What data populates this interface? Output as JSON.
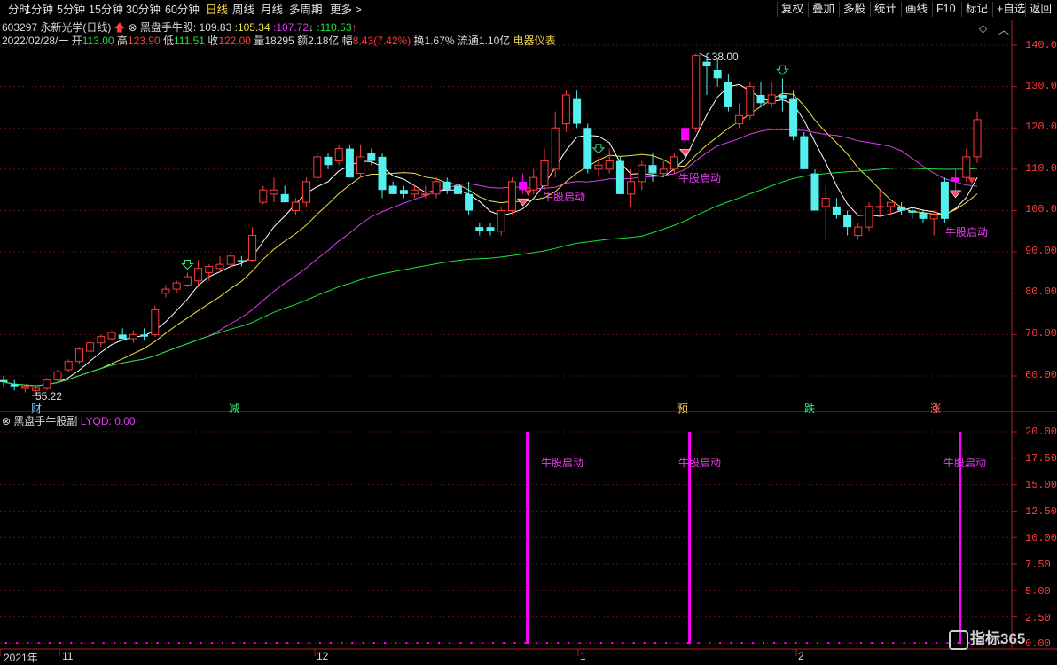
{
  "toolbar": {
    "tabs": [
      "分时",
      "1分钟",
      "5分钟",
      "15分钟",
      "30分钟",
      "60分钟",
      "日线",
      "周线",
      "月线",
      "多周期",
      "更多 >"
    ],
    "active_tab": "日线",
    "right_buttons": [
      "复权",
      "叠加",
      "多股",
      "统计",
      "画线",
      "F10",
      "标记",
      "+自选",
      "返回"
    ]
  },
  "header": {
    "code": "603297",
    "name": "永新光学",
    "period": "(日线)",
    "indicator_name": "黑盘手牛股",
    "ma1": "109.83",
    "ma2": "105.34",
    "ma3": "107.72",
    "ma4": "110.53",
    "date": "2022/02/28/一",
    "open_label": "开",
    "open": "113.00",
    "high_label": "高",
    "high": "123.90",
    "low_label": "低",
    "low": "111.51",
    "close_label": "收",
    "close": "122.00",
    "vol_label": "量",
    "vol": "18295",
    "amt_label": "额",
    "amt": "2.18亿",
    "chg_label": "幅",
    "chg": "8.43(7.42%)",
    "turnover": "换1.67%",
    "float_shares": "流通1.10亿",
    "sector": "电器仪表"
  },
  "price_axis": [
    "140.00",
    "130.00",
    "120.00",
    "110.00",
    "100.00",
    "90.00",
    "80.00",
    "70.00",
    "60.00"
  ],
  "annotations": {
    "max_label": "138.00",
    "min_label": "55.22",
    "signal": "牛股启动",
    "markers": [
      "财",
      "减",
      "预",
      "跌",
      "涨"
    ]
  },
  "sub_panel": {
    "title": "黑盘手牛股副",
    "value_label": "LYQD: 0.00",
    "axis": [
      "20.00",
      "17.50",
      "15.00",
      "12.50",
      "10.00",
      "7.50",
      "5.00",
      "2.50",
      "0.00"
    ],
    "signal_label": "牛股启动"
  },
  "x_axis": [
    "2021年",
    "11",
    "12",
    "1",
    "2"
  ],
  "logo": "指标365",
  "colors": {
    "up": "#ff3b3b",
    "down": "#54f0f0",
    "ma5": "#ffffff",
    "ma10": "#f2e24a",
    "ma20": "#e23cf2",
    "ma60": "#19e43a",
    "signal": "#ff00ff"
  },
  "chart_data": {
    "type": "candlestick",
    "ylim": [
      55,
      142
    ],
    "candles": [
      {
        "o": 59,
        "h": 60,
        "l": 57.5,
        "c": 58.5
      },
      {
        "o": 58,
        "h": 59,
        "l": 56.5,
        "c": 57.5
      },
      {
        "o": 57,
        "h": 58,
        "l": 56,
        "c": 57.5
      },
      {
        "o": 56.5,
        "h": 57.5,
        "l": 55.22,
        "c": 57
      },
      {
        "o": 57,
        "h": 59.5,
        "l": 56.5,
        "c": 59
      },
      {
        "o": 59,
        "h": 61.5,
        "l": 58.5,
        "c": 61
      },
      {
        "o": 61.5,
        "h": 64,
        "l": 61,
        "c": 63.5
      },
      {
        "o": 63.5,
        "h": 67,
        "l": 63,
        "c": 66.5
      },
      {
        "o": 66,
        "h": 69,
        "l": 65.5,
        "c": 68
      },
      {
        "o": 68,
        "h": 70,
        "l": 67,
        "c": 69.5
      },
      {
        "o": 69,
        "h": 71,
        "l": 68.5,
        "c": 70.5
      },
      {
        "o": 70,
        "h": 71.5,
        "l": 68.5,
        "c": 69
      },
      {
        "o": 69,
        "h": 71,
        "l": 68,
        "c": 70
      },
      {
        "o": 70,
        "h": 71.5,
        "l": 68.5,
        "c": 69.5
      },
      {
        "o": 70,
        "h": 77,
        "l": 69.5,
        "c": 76
      },
      {
        "o": 80,
        "h": 82,
        "l": 79,
        "c": 81
      },
      {
        "o": 81,
        "h": 83,
        "l": 80,
        "c": 82.5
      },
      {
        "o": 82,
        "h": 85,
        "l": 81.5,
        "c": 84
      },
      {
        "o": 83,
        "h": 88,
        "l": 82,
        "c": 86
      },
      {
        "o": 85,
        "h": 87,
        "l": 83,
        "c": 86.5
      },
      {
        "o": 86,
        "h": 89,
        "l": 85,
        "c": 87
      },
      {
        "o": 87,
        "h": 90,
        "l": 86,
        "c": 89
      },
      {
        "o": 88,
        "h": 89,
        "l": 86.5,
        "c": 87.5
      },
      {
        "o": 88,
        "h": 96,
        "l": 87.5,
        "c": 94
      },
      {
        "o": 102,
        "h": 106,
        "l": 101.5,
        "c": 105
      },
      {
        "o": 104,
        "h": 108,
        "l": 102,
        "c": 105
      },
      {
        "o": 104,
        "h": 106,
        "l": 102,
        "c": 102
      },
      {
        "o": 100,
        "h": 103,
        "l": 99,
        "c": 102
      },
      {
        "o": 102,
        "h": 108,
        "l": 101,
        "c": 107
      },
      {
        "o": 108,
        "h": 114,
        "l": 107,
        "c": 113
      },
      {
        "o": 113,
        "h": 114,
        "l": 110,
        "c": 111
      },
      {
        "o": 112,
        "h": 116,
        "l": 111,
        "c": 115
      },
      {
        "o": 115,
        "h": 116,
        "l": 108,
        "c": 108
      },
      {
        "o": 109,
        "h": 116,
        "l": 108,
        "c": 113
      },
      {
        "o": 114,
        "h": 115,
        "l": 111,
        "c": 112
      },
      {
        "o": 113,
        "h": 114,
        "l": 103,
        "c": 105
      },
      {
        "o": 106,
        "h": 107,
        "l": 104,
        "c": 104
      },
      {
        "o": 105,
        "h": 106,
        "l": 103,
        "c": 104
      },
      {
        "o": 104,
        "h": 106,
        "l": 103,
        "c": 105
      },
      {
        "o": 104,
        "h": 106,
        "l": 103,
        "c": 104
      },
      {
        "o": 104,
        "h": 108,
        "l": 103,
        "c": 107
      },
      {
        "o": 107,
        "h": 108,
        "l": 104,
        "c": 105
      },
      {
        "o": 106,
        "h": 108,
        "l": 104,
        "c": 104
      },
      {
        "o": 104,
        "h": 107,
        "l": 99,
        "c": 100
      },
      {
        "o": 96,
        "h": 97,
        "l": 94,
        "c": 95
      },
      {
        "o": 96,
        "h": 97,
        "l": 94,
        "c": 95
      },
      {
        "o": 95,
        "h": 101,
        "l": 94,
        "c": 100
      },
      {
        "o": 100,
        "h": 108,
        "l": 99,
        "c": 107
      },
      {
        "o": 107,
        "h": 109,
        "l": 104,
        "c": 105
      },
      {
        "o": 105,
        "h": 110,
        "l": 104,
        "c": 108
      },
      {
        "o": 106,
        "h": 115,
        "l": 105,
        "c": 112
      },
      {
        "o": 110,
        "h": 124,
        "l": 108,
        "c": 120
      },
      {
        "o": 121,
        "h": 129,
        "l": 119,
        "c": 128
      },
      {
        "o": 127,
        "h": 129,
        "l": 120,
        "c": 121
      },
      {
        "o": 120,
        "h": 121,
        "l": 109,
        "c": 110
      },
      {
        "o": 110,
        "h": 113,
        "l": 108,
        "c": 111
      },
      {
        "o": 110,
        "h": 115,
        "l": 109,
        "c": 112
      },
      {
        "o": 112,
        "h": 113,
        "l": 104,
        "c": 104
      },
      {
        "o": 104,
        "h": 110,
        "l": 101,
        "c": 107
      },
      {
        "o": 107,
        "h": 112,
        "l": 105,
        "c": 111
      },
      {
        "o": 111,
        "h": 114,
        "l": 107,
        "c": 109
      },
      {
        "o": 109,
        "h": 112,
        "l": 108,
        "c": 110
      },
      {
        "o": 110,
        "h": 114,
        "l": 109,
        "c": 113
      },
      {
        "o": 117,
        "h": 122,
        "l": 115,
        "c": 120
      },
      {
        "o": 120,
        "h": 138,
        "l": 119,
        "c": 137.5
      },
      {
        "o": 136,
        "h": 138,
        "l": 128,
        "c": 135
      },
      {
        "o": 134,
        "h": 137,
        "l": 130,
        "c": 132
      },
      {
        "o": 131,
        "h": 133,
        "l": 124,
        "c": 125
      },
      {
        "o": 121,
        "h": 126,
        "l": 120,
        "c": 123
      },
      {
        "o": 123,
        "h": 131,
        "l": 122,
        "c": 130
      },
      {
        "o": 128,
        "h": 131,
        "l": 125,
        "c": 126
      },
      {
        "o": 126,
        "h": 131,
        "l": 125,
        "c": 128
      },
      {
        "o": 128,
        "h": 132,
        "l": 124,
        "c": 127
      },
      {
        "o": 127,
        "h": 129,
        "l": 117,
        "c": 118
      },
      {
        "o": 118,
        "h": 119,
        "l": 110,
        "c": 110
      },
      {
        "o": 109,
        "h": 110,
        "l": 100,
        "c": 100
      },
      {
        "o": 101,
        "h": 106,
        "l": 93,
        "c": 103
      },
      {
        "o": 101,
        "h": 103,
        "l": 98,
        "c": 99
      },
      {
        "o": 99,
        "h": 100,
        "l": 94,
        "c": 96
      },
      {
        "o": 94,
        "h": 97,
        "l": 93,
        "c": 96
      },
      {
        "o": 96,
        "h": 102,
        "l": 95,
        "c": 101
      },
      {
        "o": 101,
        "h": 105,
        "l": 99,
        "c": 101
      },
      {
        "o": 101,
        "h": 102,
        "l": 99,
        "c": 102
      },
      {
        "o": 101,
        "h": 102,
        "l": 99,
        "c": 100
      },
      {
        "o": 100,
        "h": 101,
        "l": 98,
        "c": 99.5
      },
      {
        "o": 99.5,
        "h": 100,
        "l": 97,
        "c": 98
      },
      {
        "o": 98,
        "h": 100,
        "l": 94,
        "c": 99
      },
      {
        "o": 107,
        "h": 108,
        "l": 97,
        "c": 98
      },
      {
        "o": 107,
        "h": 110,
        "l": 105,
        "c": 108
      },
      {
        "o": 108,
        "h": 115,
        "l": 107,
        "c": 113
      },
      {
        "o": 113,
        "h": 124,
        "l": 111.51,
        "c": 122
      }
    ],
    "magenta_bars": [
      48,
      63,
      88
    ],
    "signal_bars": [
      48,
      63,
      88
    ],
    "down_arrows": [
      17,
      55,
      72
    ],
    "up_arrows": [
      48,
      89
    ]
  }
}
